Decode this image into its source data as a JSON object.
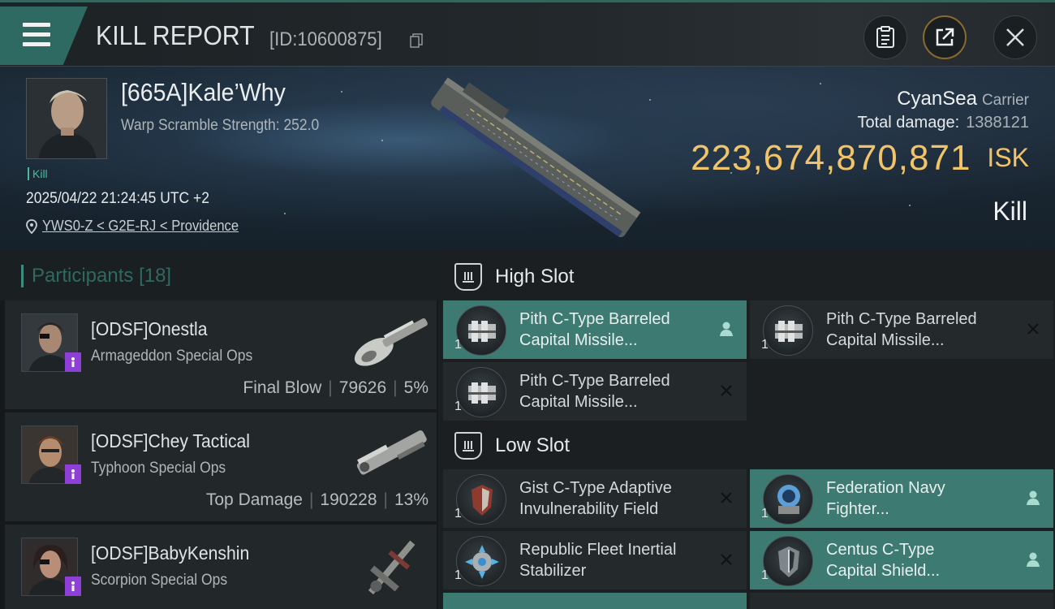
{
  "header": {
    "title": "KILL REPORT",
    "report_id": "[ID:10600875]",
    "icons": [
      "menu-icon",
      "copy-icon",
      "report-icon",
      "share-icon",
      "close-icon"
    ],
    "accent_color": "#2f6a62"
  },
  "victim": {
    "name": "[665A]Kale’Why",
    "warp_scramble": "Warp Scramble Strength: 252.0",
    "tag": "Kill",
    "datetime": "2025/04/22 21:24:45 UTC +2",
    "location": "YWS0-Z < G2E-RJ < Providence",
    "ship_name": "CyanSea",
    "ship_class": "Carrier",
    "total_damage_label": "Total damage:",
    "total_damage_value": "1388121",
    "isk_value": "223,674,870,871",
    "isk_unit": "ISK",
    "result": "Kill",
    "isk_color": "#f1c46a"
  },
  "participants": {
    "title": "Participants",
    "count": "[18]",
    "items": [
      {
        "name": "[ODSF]Onestla",
        "ship": "Armageddon Special Ops",
        "role": "Final Blow",
        "damage": "79626",
        "percent": "5%"
      },
      {
        "name": "[ODSF]Chey Tactical",
        "ship": "Typhoon Special Ops",
        "role": "Top Damage",
        "damage": "190228",
        "percent": "13%"
      },
      {
        "name": "[ODSF]BabyKenshin",
        "ship": "Scorpion Special Ops",
        "role": "",
        "damage": "",
        "percent": ""
      }
    ]
  },
  "modules": {
    "high_slot_label": "High Slot",
    "low_slot_label": "Low Slot",
    "high": [
      {
        "qty": "1",
        "line1": "Pith C-Type Barreled",
        "line2": "Capital Missile...",
        "state": "person-icon",
        "active": true
      },
      {
        "qty": "1",
        "line1": "Pith C-Type Barreled",
        "line2": "Capital Missile...",
        "state": "x-icon",
        "active": false
      },
      {
        "qty": "1",
        "line1": "Pith C-Type Barreled",
        "line2": "Capital Missile...",
        "state": "x-icon",
        "active": false
      }
    ],
    "low": [
      {
        "qty": "1",
        "line1": "Gist C-Type Adaptive",
        "line2": "Invulnerability Field",
        "state": "x-icon",
        "active": false
      },
      {
        "qty": "1",
        "line1": "Federation Navy",
        "line2": "Fighter...",
        "state": "person-icon",
        "active": true
      },
      {
        "qty": "1",
        "line1": "Republic Fleet Inertial",
        "line2": "Stabilizer",
        "state": "x-icon",
        "active": false
      },
      {
        "qty": "1",
        "line1": "Centus C-Type",
        "line2": "Capital Shield...",
        "state": "person-icon",
        "active": true
      }
    ]
  }
}
